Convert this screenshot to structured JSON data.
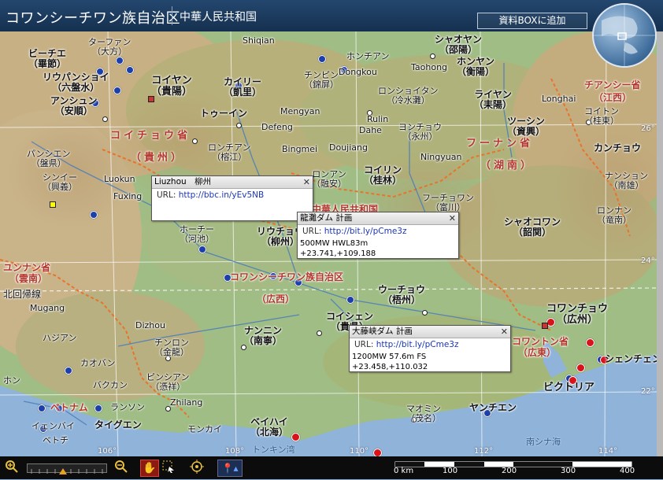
{
  "header": {
    "title": "コワンシーチワン族自治区",
    "country": "中華人民共和国",
    "add_button": "資料BOXに追加"
  },
  "provinces": [
    {
      "id": "guizhou",
      "name": "コイチョウ省"
    },
    {
      "id": "guizhou-kanji",
      "name": "（貴州）"
    },
    {
      "id": "hunan",
      "name": "フーナン省"
    },
    {
      "id": "hunan-kanji",
      "name": "（湖南）"
    },
    {
      "id": "jiangxi",
      "name": "チアンシー省"
    },
    {
      "id": "jiangxi-kanji",
      "name": "（江西）"
    },
    {
      "id": "yunnan",
      "name": "ユンナン省"
    },
    {
      "id": "yunnan-kanji",
      "name": "（雲南）"
    },
    {
      "id": "guangxi",
      "name": "コワンシーチワン族自治区"
    },
    {
      "id": "guangxi-kanji",
      "name": "（広西）"
    },
    {
      "id": "guangdong",
      "name": "コワントン省"
    },
    {
      "id": "guangdong-kanji",
      "name": "（広東）"
    },
    {
      "id": "vietnam",
      "name": "ベトナム"
    },
    {
      "id": "prc",
      "name": "中華人民共和国"
    }
  ],
  "places": [
    {
      "id": "shiqian",
      "t": "Shiqian"
    },
    {
      "id": "tarfan",
      "t": "ターファン\n（大方）"
    },
    {
      "id": "bijie",
      "t": "ビーチエ\n（畢節）"
    },
    {
      "id": "liupanshui",
      "t": "リウパンショイ\n（六盤水）"
    },
    {
      "id": "anshun",
      "t": "アンシュン\n（安順）"
    },
    {
      "id": "guiyang",
      "t": "コイヤン\n（貴陽）"
    },
    {
      "id": "kaili",
      "t": "カイリー\n（凱里）"
    },
    {
      "id": "duyun",
      "t": "トゥーイン"
    },
    {
      "id": "jinping",
      "t": "チンピン\n（錦屏）"
    },
    {
      "id": "hongjiang",
      "t": "ホンチアン"
    },
    {
      "id": "dongkou",
      "t": "Dongkou"
    },
    {
      "id": "shaoyang",
      "t": "シャオヤン\n（邵陽）"
    },
    {
      "id": "hengyang",
      "t": "ホンヤン\n（衡陽）"
    },
    {
      "id": "taohong",
      "t": "Taohong"
    },
    {
      "id": "lengshuitan",
      "t": "ロンショイタン\n（冷水灘）"
    },
    {
      "id": "leiyang",
      "t": "ライヤン\n（耒陽）"
    },
    {
      "id": "longhai",
      "t": "Longhai"
    },
    {
      "id": "yongzhou",
      "t": "ヨンチョウ\n（永州）"
    },
    {
      "id": "chenzhou",
      "t": "ツーシン\n（資興）"
    },
    {
      "id": "jishou",
      "t": "コイトン\n（桂東）"
    },
    {
      "id": "ganzhou",
      "t": "カンチョウ"
    },
    {
      "id": "mengyan",
      "t": "Mengyan"
    },
    {
      "id": "defeng",
      "t": "Defeng"
    },
    {
      "id": "rulin",
      "t": "Rulin"
    },
    {
      "id": "dahe",
      "t": "Dahe"
    },
    {
      "id": "bingmei",
      "t": "Bingmei"
    },
    {
      "id": "doujiang",
      "t": "Doujiang"
    },
    {
      "id": "ningyuan",
      "t": "Ningyuan"
    },
    {
      "id": "rongjiang",
      "t": "ロンチアン\n（榕江）"
    },
    {
      "id": "panxian",
      "t": "パンシエン\n（盤県）"
    },
    {
      "id": "xingyi",
      "t": "シンイー\n（興義）"
    },
    {
      "id": "luokun",
      "t": "Luokun"
    },
    {
      "id": "fuxing",
      "t": "Fuxing"
    },
    {
      "id": "rongan",
      "t": "ロンアン\n（融安）"
    },
    {
      "id": "guilin",
      "t": "コイリン\n（桂林）"
    },
    {
      "id": "fuchuan",
      "t": "フーチョワン\n（富川）"
    },
    {
      "id": "nanxiong",
      "t": "ナンション\n（南雄）"
    },
    {
      "id": "shaoguan",
      "t": "シャオコワン\n（韶関）"
    },
    {
      "id": "longnan",
      "t": "ロンナン\n（竜南）"
    },
    {
      "id": "hechi",
      "t": "ホーチー\n（河池）"
    },
    {
      "id": "liuzhou",
      "t": "リウチョウ\n（柳州）"
    },
    {
      "id": "wuzhou",
      "t": "ウーチョウ\n（梧州）"
    },
    {
      "id": "guiping",
      "t": "コイシェン\n（貴県）"
    },
    {
      "id": "guangzhou",
      "t": "コワンチョウ\n（広州）"
    },
    {
      "id": "mugang",
      "t": "Mugang"
    },
    {
      "id": "dizhou",
      "t": "Dizhou"
    },
    {
      "id": "hajian",
      "t": "ハジアン"
    },
    {
      "id": "nanning",
      "t": "ナンニン\n（南寧）"
    },
    {
      "id": "jinlong",
      "t": "チンロン\n（金龍）"
    },
    {
      "id": "pingxiang",
      "t": "ピンシアン\n（憑祥）"
    },
    {
      "id": "caobang",
      "t": "カオバン"
    },
    {
      "id": "bakan",
      "t": "バクカン"
    },
    {
      "id": "zhilang",
      "t": "Zhilang"
    },
    {
      "id": "langson",
      "t": "ランソン"
    },
    {
      "id": "taiyuan",
      "t": "タイグエン"
    },
    {
      "id": "haiphong",
      "t": "ベトチ"
    },
    {
      "id": "yinbai",
      "t": "イェンバイ"
    },
    {
      "id": "mongcai",
      "t": "モンカイ"
    },
    {
      "id": "beihai",
      "t": "ベイハイ\n（北海）"
    },
    {
      "id": "maoming",
      "t": "マオミン\n（茂名）"
    },
    {
      "id": "yangjiang",
      "t": "ヤンチエン"
    },
    {
      "id": "shenzhen",
      "t": "シェンチェン"
    },
    {
      "id": "victoria",
      "t": "ビクトリア"
    },
    {
      "id": "tropic",
      "t": "北回帰線"
    },
    {
      "id": "tonkin",
      "t": "トンキン湾"
    },
    {
      "id": "southsea",
      "t": "南シナ海"
    },
    {
      "id": "ho",
      "t": "ホン"
    }
  ],
  "coords": {
    "lon": [
      "106°",
      "108°",
      "110°",
      "112°",
      "114°"
    ],
    "lat": [
      "26°",
      "24°",
      "22°"
    ]
  },
  "popups": [
    {
      "id": "liuzhou",
      "title": "Liuzhou　柳州",
      "url_label": "URL:",
      "url": "http://bbc.in/yEv5NB",
      "lines": []
    },
    {
      "id": "longtan",
      "title": "龍灘ダム 計画",
      "url_label": "URL:",
      "url": "http://bit.ly/pCme3z",
      "lines": [
        "500MW HWL83m",
        "+23.741,+109.188"
      ]
    },
    {
      "id": "datengxia",
      "title": "大藤峡ダム 計画",
      "url_label": "URL:",
      "url": "http://bit.ly/pCme3z",
      "lines": [
        "1200MW 57.6m FS",
        "+23.458,+110.032"
      ]
    }
  ],
  "scale": {
    "ticks": [
      "0 km",
      "100",
      "200",
      "300",
      "400"
    ]
  },
  "toolbar": {
    "zoom_in": "zoom-in",
    "zoom_out": "zoom-out",
    "pan": "hand",
    "select": "select",
    "target": "target",
    "pin": "pin"
  }
}
